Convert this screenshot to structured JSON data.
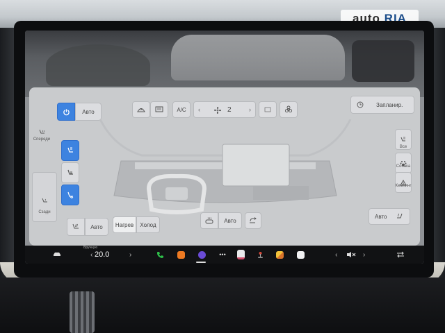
{
  "watermark": {
    "part1": "auto",
    "part2": "RIA"
  },
  "top_bar": {
    "auto_label": "Авто",
    "ac_label": "A/C",
    "fan_speed": "2",
    "schedule_label": "Запланир."
  },
  "left_panel": {
    "front_label": "Спереди",
    "rear_label": "Сзади"
  },
  "right_panel": {
    "all_label": "Все",
    "dog_label": "Собака",
    "camp_label": "Кемпинг"
  },
  "bottom_controls": {
    "seat_auto_label": "Авто",
    "heat_label": "Нагрев",
    "cool_label": "Холод",
    "vent_auto_label": "Авто",
    "right_auto_label": "Авто"
  },
  "taskbar": {
    "temp_caption": "Вручную",
    "temp_value": "20.0"
  },
  "colors": {
    "accent": "#3d83e0",
    "panel": "#c9cbcd",
    "taskbar": "#111214"
  }
}
